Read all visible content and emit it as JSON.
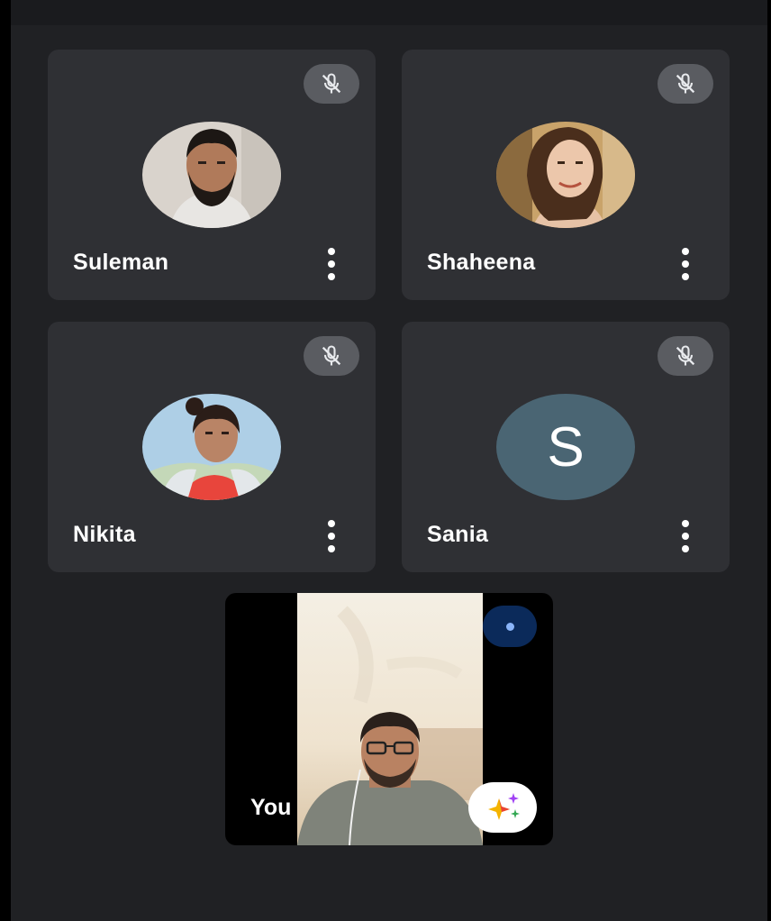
{
  "participants": [
    {
      "name": "Suleman",
      "avatar": "photo",
      "muted": true
    },
    {
      "name": "Shaheena",
      "avatar": "photo",
      "muted": true
    },
    {
      "name": "Nikita",
      "avatar": "photo",
      "muted": true
    },
    {
      "name": "Sania",
      "avatar": "letter",
      "initial": "S",
      "muted": true
    }
  ],
  "self": {
    "label": "You"
  },
  "icons": {
    "mute": "mic-off-icon",
    "menu": "more-vert-icon",
    "effects": "sparkle-effects-icon",
    "speaking": "speaking-indicator-icon"
  },
  "colors": {
    "background": "#202124",
    "tile": "#2f3034",
    "mute_badge": "#5a5c61",
    "letter_avatar": "#4a6573"
  }
}
